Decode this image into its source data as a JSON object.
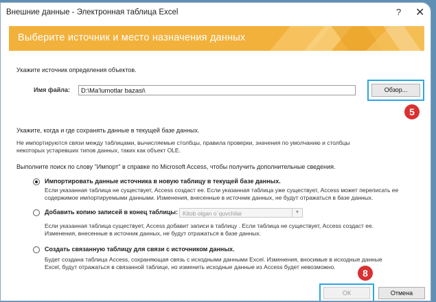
{
  "window": {
    "title": "Внешние данные - Электронная таблица Excel",
    "help": "?",
    "close": "✕"
  },
  "banner": {
    "text": "Выберите источник и место назначения данных"
  },
  "source": {
    "heading": "Укажите источник определения объектов.",
    "file_label": "Имя файла:",
    "file_value": "D:\\Ma'lumotlar bazasi\\",
    "browse_label": "Обзор..."
  },
  "dest": {
    "heading": "Укажите, когда и где сохранять данные в текущей базе данных.",
    "note": "Не импортируются связи между таблицами, вычисляемые столбцы, правила проверки, значения по умолчанию и столбцы\nнекоторых устаревших типов данных, таких как объект OLE.",
    "help": "Выполните поиск по слову \"Импорт\" в справке по Microsoft Access, чтобы получить дополнительные сведения."
  },
  "options": [
    {
      "label": "Импортировать данные источника в новую таблицу в текущей базе данных.",
      "desc": "Если указанная таблица не существует, Access создаст ее. Если указанная таблица уже существует, Access может переписать ее\nсодержимое импортируемыми данными. Изменения, внесенные в источник данных, не будут отражаться в базе данных.",
      "selected": true
    },
    {
      "label": "Добавить копию записей в конец таблицы:",
      "desc": "Если указанная таблица существует, Access добавит записи в таблицу . Если таблица не существует, Access создаст ее.\nИзменения, внесенные в источник данных, не будут отражаться в базе данных.",
      "selected": false,
      "table_value": "Kitob olgan o`quvchilar"
    },
    {
      "label": "Создать связанную таблицу для связи с источником данных.",
      "desc": "Будет создана таблица Access, сохраняющая связь с исходными данными Excel. Изменения, вносимые в исходные данные\nExcel, будут отражаться в связанной таблице, но изменить исходные данные из Access будет невозможно.",
      "selected": false
    }
  ],
  "buttons": {
    "ok": "ОК",
    "cancel": "Отмена"
  },
  "badges": {
    "browse": "5",
    "ok": "8"
  }
}
